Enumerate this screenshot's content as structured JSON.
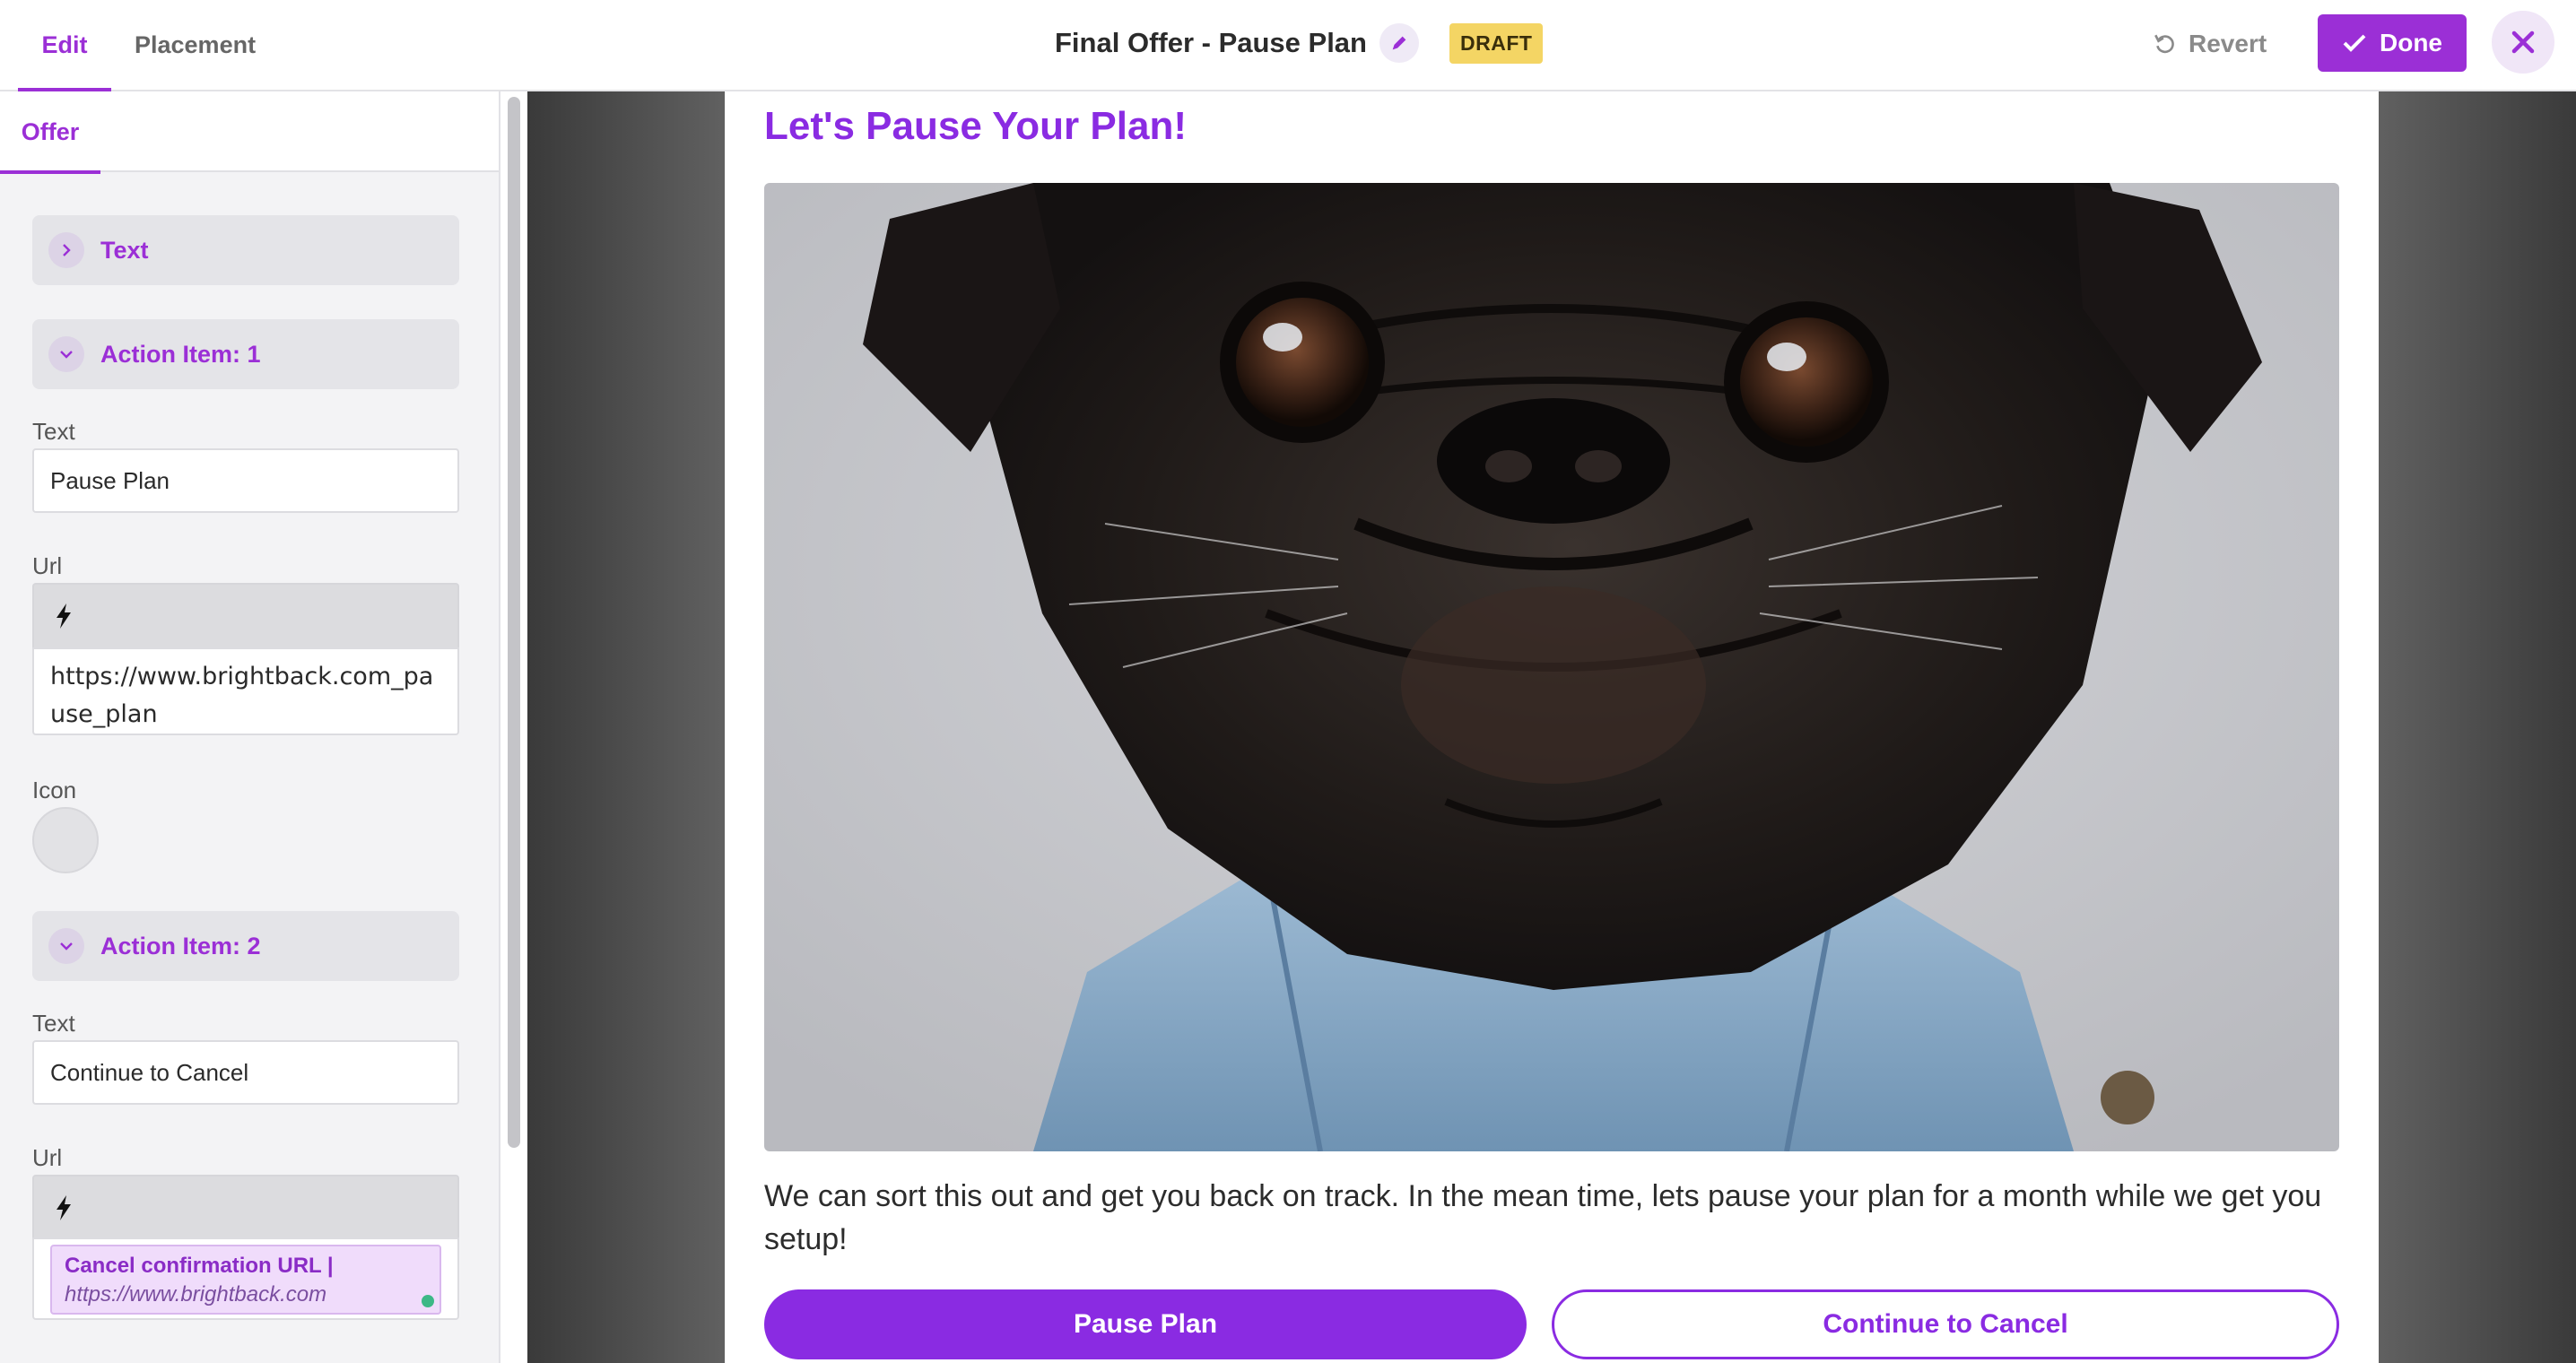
{
  "header": {
    "tabs": {
      "edit": "Edit",
      "placement": "Placement"
    },
    "title": "Final Offer - Pause Plan",
    "status_badge": "DRAFT",
    "revert_label": "Revert",
    "done_label": "Done",
    "icons": {
      "edit": "pencil-icon",
      "revert": "undo-icon",
      "done": "check-icon",
      "close": "close-icon"
    }
  },
  "sidebar": {
    "tab": "Offer",
    "sections": {
      "text": "Text",
      "action_item_1": "Action Item: 1",
      "action_item_2": "Action Item: 2"
    },
    "action_item_1": {
      "text_label": "Text",
      "text_value": "Pause Plan",
      "url_label": "Url",
      "url_value": "https://www.brightback.com_pause_plan",
      "icon_label": "Icon"
    },
    "action_item_2": {
      "text_label": "Text",
      "text_value": "Continue to Cancel",
      "url_label": "Url",
      "token_title": "Cancel confirmation URL |",
      "token_url": "https://www.brightback.com"
    }
  },
  "preview": {
    "title": "Let's Pause Your Plan!",
    "image": "pug-in-denim-jacket-photo",
    "body": "We can sort this out and get you back on track. In the mean time, lets pause your plan for a month while we get you setup!",
    "primary_button": "Pause Plan",
    "secondary_button": "Continue to Cancel"
  },
  "colors": {
    "accent": "#9b2fd6",
    "preview_accent": "#8a2be2",
    "draft_badge": "#f4d564",
    "token_dot": "#3db886"
  }
}
